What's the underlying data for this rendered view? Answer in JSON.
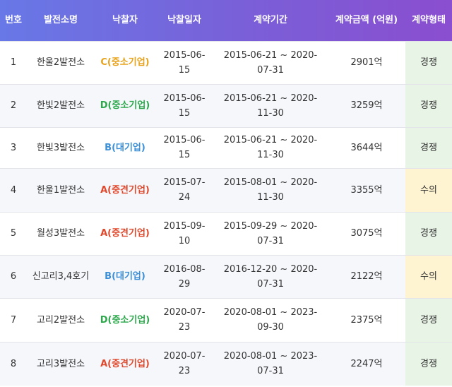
{
  "headers": [
    "번호",
    "발전소명",
    "낙찰자",
    "낙찰일자",
    "계약기간",
    "계약금액 (억원)",
    "계약형태"
  ],
  "colors": {
    "C": "#e8a21a",
    "D": "#2aa84a",
    "B": "#3a8fd8",
    "A": "#e0482c",
    "competitive_bg": "#e8f4e6",
    "private_bg": "#fff4d1"
  },
  "rows": [
    {
      "no": "1",
      "plant": "한울2발전소",
      "bidder": "C(중소기업)",
      "grade": "C",
      "date": "2015-06-15",
      "period": "2015-06-21 ~ 2020-07-31",
      "amount": "2901억",
      "ctype": "경쟁",
      "ctype_kind": "competitive"
    },
    {
      "no": "2",
      "plant": "한빛2발전소",
      "bidder": "D(중소기업)",
      "grade": "D",
      "date": "2015-06-15",
      "period": "2015-06-21 ~ 2020-11-30",
      "amount": "3259억",
      "ctype": "경쟁",
      "ctype_kind": "competitive"
    },
    {
      "no": "3",
      "plant": "한빛3발전소",
      "bidder": "B(대기업)",
      "grade": "B",
      "date": "2015-06-15",
      "period": "2015-06-21 ~ 2020-11-30",
      "amount": "3644억",
      "ctype": "경쟁",
      "ctype_kind": "competitive"
    },
    {
      "no": "4",
      "plant": "한울1발전소",
      "bidder": "A(중견기업)",
      "grade": "A",
      "date": "2015-07-24",
      "period": "2015-08-01 ~ 2020-11-30",
      "amount": "3355억",
      "ctype": "수의",
      "ctype_kind": "private"
    },
    {
      "no": "5",
      "plant": "월성3발전소",
      "bidder": "A(중견기업)",
      "grade": "A",
      "date": "2015-09-10",
      "period": "2015-09-29 ~ 2020-07-31",
      "amount": "3075억",
      "ctype": "경쟁",
      "ctype_kind": "competitive"
    },
    {
      "no": "6",
      "plant": "신고리3,4호기",
      "bidder": "B(대기업)",
      "grade": "B",
      "date": "2016-08-29",
      "period": "2016-12-20 ~ 2020-07-31",
      "amount": "2122억",
      "ctype": "수의",
      "ctype_kind": "private"
    },
    {
      "no": "7",
      "plant": "고리2발전소",
      "bidder": "D(중소기업)",
      "grade": "D",
      "date": "2020-07-23",
      "period": "2020-08-01 ~ 2023-09-30",
      "amount": "2375억",
      "ctype": "경쟁",
      "ctype_kind": "competitive"
    },
    {
      "no": "8",
      "plant": "고리3발전소",
      "bidder": "A(중견기업)",
      "grade": "A",
      "date": "2020-07-23",
      "period": "2020-08-01 ~ 2023-07-31",
      "amount": "2247억",
      "ctype": "경쟁",
      "ctype_kind": "competitive"
    }
  ]
}
